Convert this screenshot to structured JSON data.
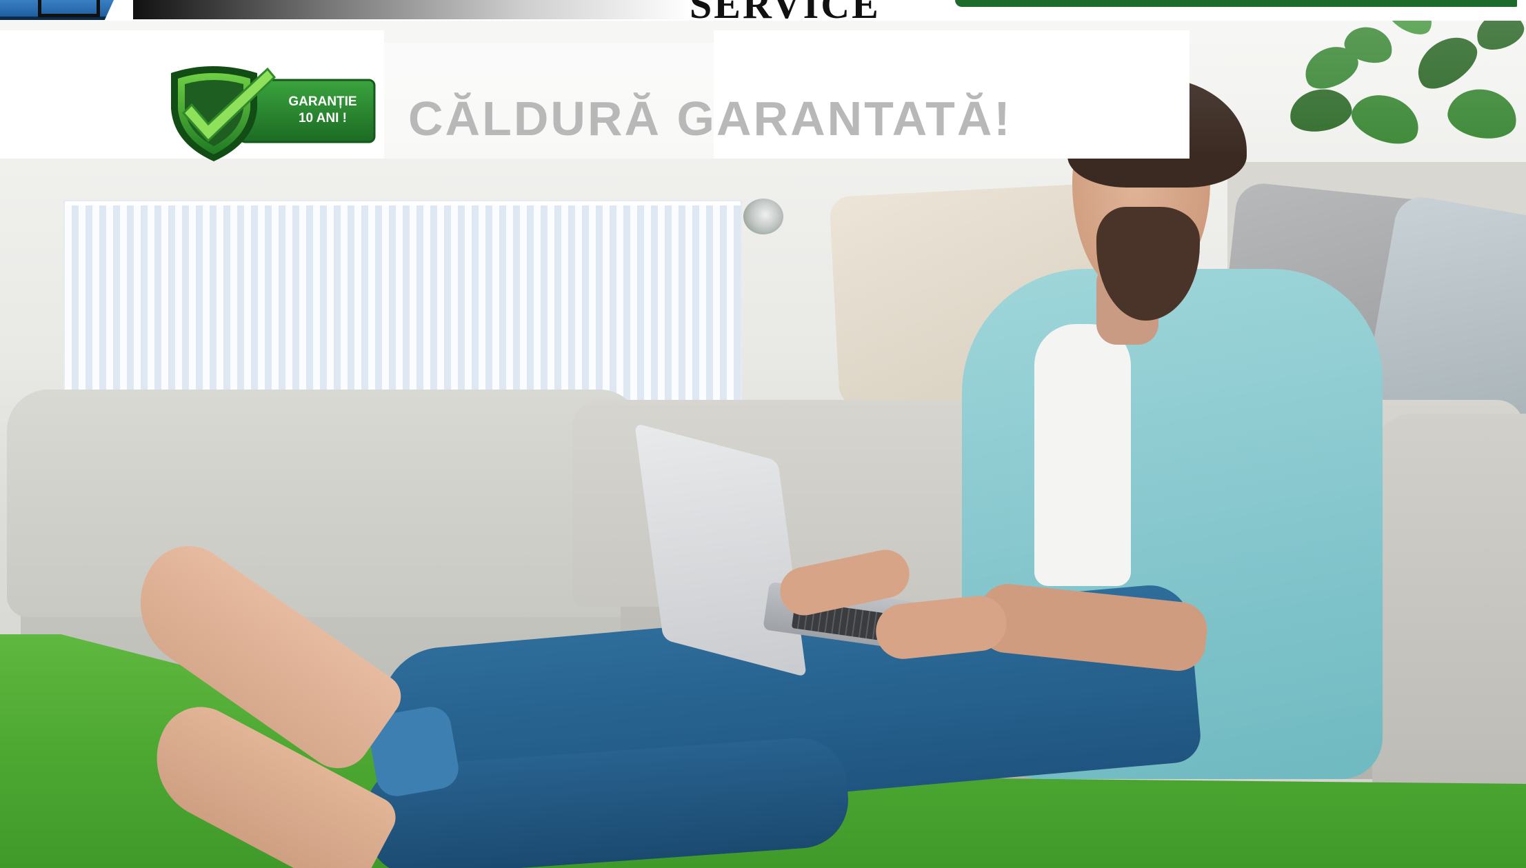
{
  "brand": {
    "service_text": "SERVICE"
  },
  "badge": {
    "line1": "GARANȚIE",
    "line2": "10 ANI !",
    "icon": "shield-check-icon"
  },
  "headline": "CĂLDURĂ GARANTATĂ!",
  "colors": {
    "brand_green": "#1c6b2c",
    "badge_green": "#2a8a36",
    "headline_grey": "#b8b8b8",
    "carpet_green": "#4da832"
  }
}
